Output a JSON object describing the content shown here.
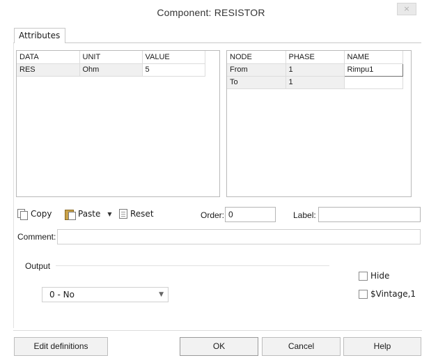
{
  "window": {
    "title": "Component: RESISTOR",
    "close_label": "×"
  },
  "tabs": [
    {
      "label": "Attributes",
      "active": true
    }
  ],
  "attributes_grid": {
    "columns": [
      "DATA",
      "UNIT",
      "VALUE"
    ],
    "rows": [
      {
        "data": "RES",
        "unit": "Ohm",
        "value": "5"
      }
    ]
  },
  "nodes_grid": {
    "columns": [
      "NODE",
      "PHASE",
      "NAME"
    ],
    "rows": [
      {
        "node": "From",
        "phase": "1",
        "name": "Rimpu1"
      },
      {
        "node": "To",
        "phase": "1",
        "name": ""
      }
    ]
  },
  "toolbar": {
    "copy_label": "Copy",
    "paste_label": "Paste",
    "reset_label": "Reset"
  },
  "order": {
    "label": "Order:",
    "value": "0"
  },
  "label_field": {
    "label": "Label:",
    "value": ""
  },
  "comment": {
    "label": "Comment:",
    "value": ""
  },
  "output": {
    "label": "Output",
    "selected": "0 - No"
  },
  "checkboxes": [
    {
      "label": "Hide",
      "checked": false
    },
    {
      "label": "$Vintage,1",
      "checked": false
    }
  ],
  "buttons": {
    "edit_definitions": "Edit definitions",
    "ok": "OK",
    "cancel": "Cancel",
    "help": "Help"
  }
}
